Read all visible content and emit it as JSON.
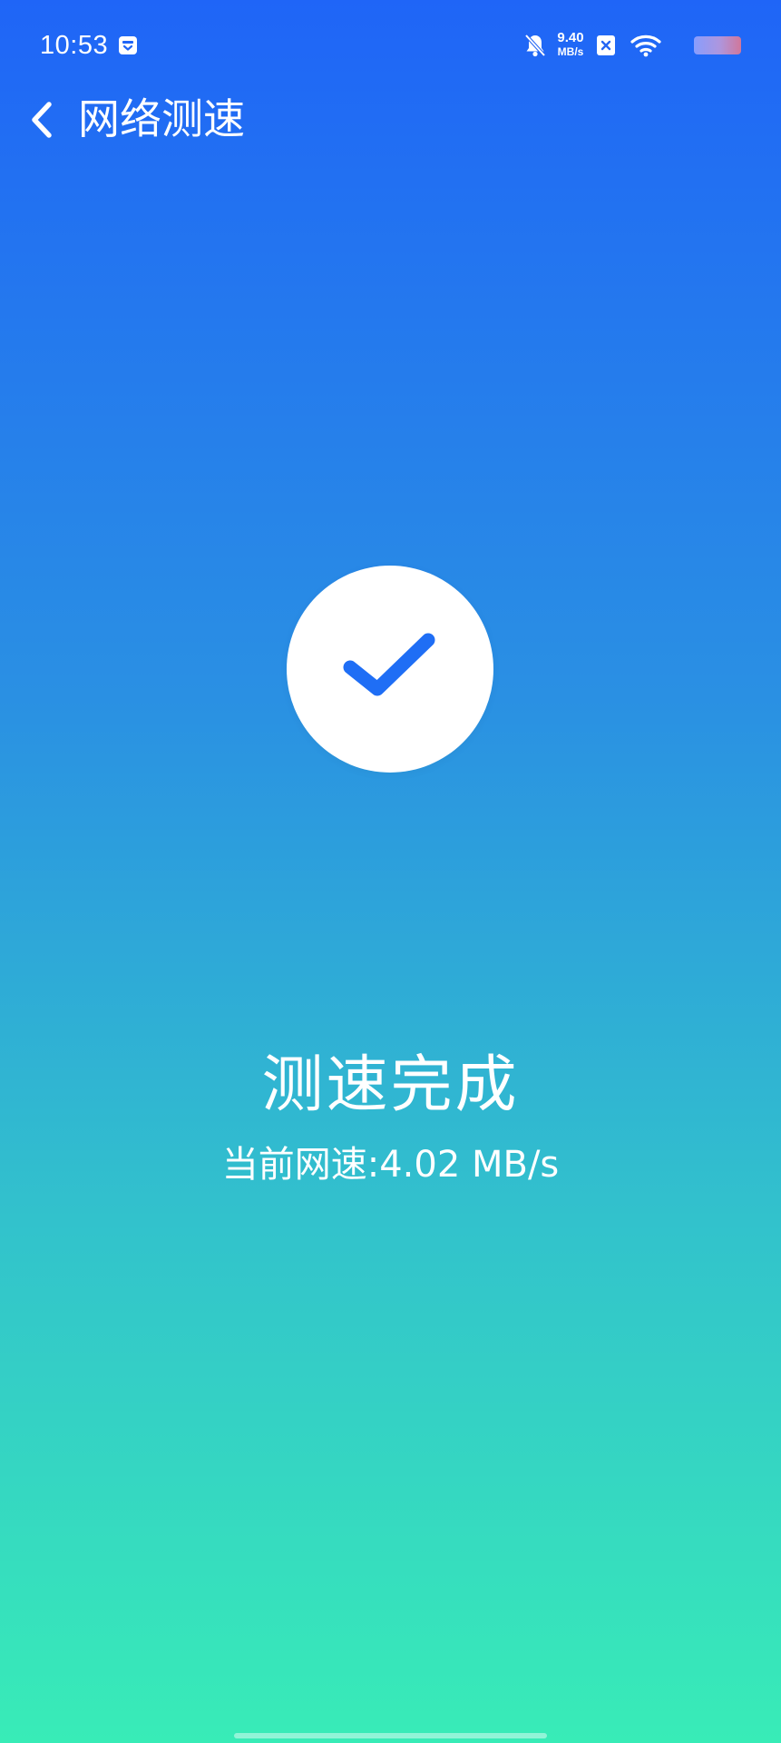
{
  "status_bar": {
    "time": "10:53",
    "net_speed_value": "9.40",
    "net_speed_unit": "MB/s",
    "icons": [
      "app-notification-icon",
      "mute-icon",
      "sim-icon",
      "wifi-icon",
      "battery-icon"
    ]
  },
  "header": {
    "title": "网络测速",
    "back_icon": "chevron-left-icon"
  },
  "result": {
    "icon": "check-icon",
    "title": "测速完成",
    "speed_text": "当前网速:4.02 MB/s"
  },
  "colors": {
    "gradient_top": "#1f65f7",
    "gradient_bottom": "#38ecb7",
    "accent": "#1f6ef5",
    "text": "#ffffff"
  }
}
